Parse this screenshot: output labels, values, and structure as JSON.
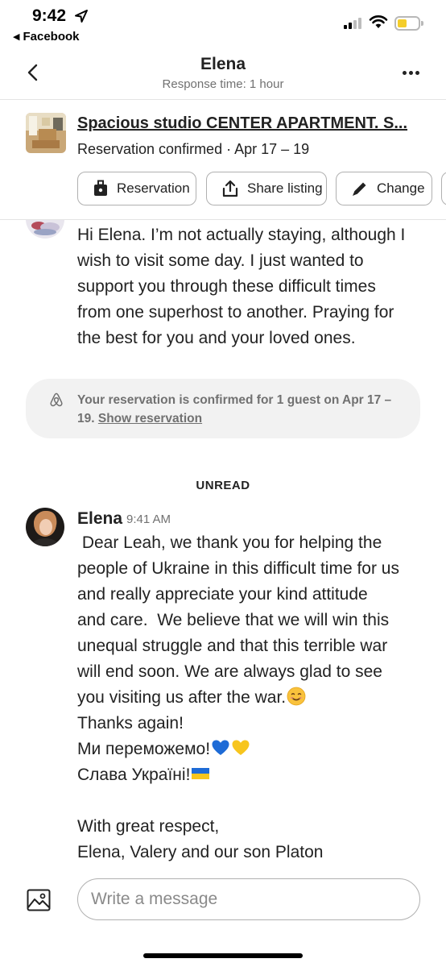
{
  "status_bar": {
    "time": "9:42",
    "back_app": "Facebook",
    "back_glyph": "◀"
  },
  "header": {
    "title": "Elena",
    "subtitle": "Response time: 1 hour"
  },
  "listing": {
    "title": "Spacious studio CENTER APARTMENT. S...",
    "status": "Reservation confirmed · Apr 17 – 19",
    "actions": [
      {
        "label": "Reservation",
        "icon": "briefcase-icon"
      },
      {
        "label": "Share listing",
        "icon": "share-icon"
      },
      {
        "label": "Change",
        "icon": "pencil-icon"
      }
    ]
  },
  "messages": {
    "previous": {
      "lines": [
        "Hi Elena. I’m not actually staying, although I",
        "wish to visit some day. I just wanted to",
        "support you through these difficult times",
        "from one superhost to another. Praying for",
        "the best for you and your loved ones."
      ]
    },
    "notice": {
      "text": "Your reservation is confirmed for 1 guest on Apr 17 – 19.",
      "link": "Show reservation"
    },
    "divider": "UNREAD",
    "latest": {
      "sender": "Elena",
      "time": "9:41 AM",
      "lines": [
        " Dear Leah, we thank you for helping the",
        "people of Ukraine in this difficult time for us",
        "and really appreciate your kind attitude",
        "and care.  We believe that we will win this",
        "unequal struggle and that this terrible war",
        "will end soon. We are always glad to see",
        "you visiting us after the war.",
        "Thanks again!",
        "Ми переможемо!",
        "Слава Україні!",
        "With great respect,",
        "Elena, Valery and our son Platon"
      ]
    }
  },
  "composer": {
    "placeholder": "Write a message"
  },
  "colors": {
    "text": "#222222",
    "muted": "#717171",
    "border": "#b0b0b0",
    "notice_bg": "#f2f2f2",
    "battery": "#f4cd2a",
    "heart_blue": "#1e6bd6",
    "heart_yellow": "#f7c51e"
  }
}
